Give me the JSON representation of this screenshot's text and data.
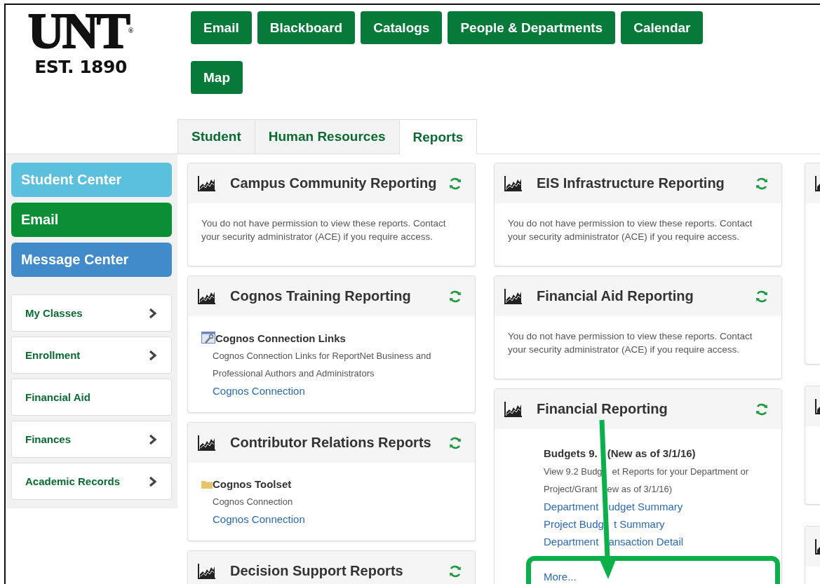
{
  "logo": {
    "name": "UNT",
    "mark": "®",
    "tagline": "EST. 1890"
  },
  "nav": [
    "Email",
    "Blackboard",
    "Catalogs",
    "People & Departments",
    "Calendar",
    "Map"
  ],
  "tabs": [
    {
      "label": "Student",
      "selected": false
    },
    {
      "label": "Human Resources",
      "selected": false
    },
    {
      "label": "Reports",
      "selected": true
    }
  ],
  "sidebar": {
    "buttons": [
      {
        "label": "Student Center",
        "kind": "info"
      },
      {
        "label": "Email",
        "kind": "success"
      },
      {
        "label": "Message Center",
        "kind": "primary"
      }
    ],
    "items": [
      {
        "label": "My Classes",
        "has_submenu": true
      },
      {
        "label": "Enrollment",
        "has_submenu": true
      },
      {
        "label": "Financial Aid",
        "has_submenu": false
      },
      {
        "label": "Finances",
        "has_submenu": true
      },
      {
        "label": "Academic Records",
        "has_submenu": true
      }
    ]
  },
  "columns": [
    [
      {
        "title": "Campus Community Reporting",
        "kind": "denied",
        "message": "You do not have permission to view these reports. Contact your security administrator (ACE) if you require access."
      },
      {
        "title": "Cognos Training Reporting",
        "kind": "links",
        "sections": [
          {
            "kind": "tools",
            "heading": "Cognos Connection Links",
            "description": "Cognos Connection Links for ReportNet Business and Professional Authors and Administrators",
            "links": [
              "Cognos Connection"
            ]
          }
        ]
      },
      {
        "title": "Contributor Relations Reports",
        "kind": "links",
        "sections": [
          {
            "kind": "folder",
            "heading": "Cognos Toolset",
            "description": "Cognos Connection",
            "links": [
              "Cognos Connection"
            ]
          }
        ]
      },
      {
        "title": "Decision Support Reports",
        "kind": "links"
      }
    ],
    [
      {
        "title": "EIS Infrastructure Reporting",
        "kind": "denied",
        "message": "You do not have permission to view these reports. Contact your security administrator (ACE) if you require access."
      },
      {
        "title": "Financial Aid Reporting",
        "kind": "denied",
        "message": "You do not have permission to view these reports. Contact your security administrator (ACE) if you require access."
      },
      {
        "title": "Financial Reporting",
        "kind": "budget",
        "rows": [
          {
            "kind": "heading",
            "parts": [
              "Budgets 9.",
              "(New as of 3/1/16)"
            ]
          },
          {
            "kind": "text",
            "parts": [
              "View 9.2 Budg",
              "et Reports for your Department or"
            ]
          },
          {
            "kind": "text",
            "parts": [
              "Project/Grant",
              "ew as of 3/1/16)"
            ]
          },
          {
            "kind": "link",
            "parts": [
              "Department",
              "udget Summary"
            ]
          },
          {
            "kind": "link",
            "parts": [
              "Project Budg",
              "t Summary"
            ]
          },
          {
            "kind": "link",
            "parts": [
              "Department",
              "ansaction Detail"
            ]
          }
        ],
        "more": "More..."
      }
    ]
  ],
  "annotation": {
    "arrow": true,
    "highlight_box": true
  }
}
